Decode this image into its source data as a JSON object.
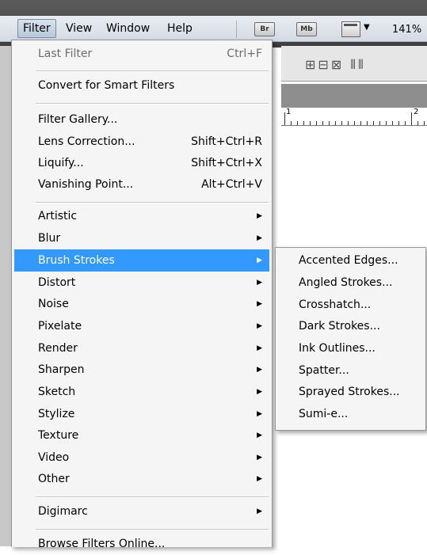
{
  "menubar": {
    "items": [
      "Filter",
      "View",
      "Window",
      "Help"
    ],
    "badges": [
      "Br",
      "Mb"
    ],
    "zoom": "141%"
  },
  "ruler": {
    "numbers": [
      "1",
      "2"
    ]
  },
  "filter_menu": {
    "last_filter": {
      "label": "Last Filter",
      "shortcut": "Ctrl+F"
    },
    "convert": "Convert for Smart Filters",
    "filter_gallery": "Filter Gallery...",
    "lens_correction": {
      "label": "Lens Correction...",
      "shortcut": "Shift+Ctrl+R"
    },
    "liquify": {
      "label": "Liquify...",
      "shortcut": "Shift+Ctrl+X"
    },
    "vanishing_point": {
      "label": "Vanishing Point...",
      "shortcut": "Alt+Ctrl+V"
    },
    "groups": [
      "Artistic",
      "Blur",
      "Brush Strokes",
      "Distort",
      "Noise",
      "Pixelate",
      "Render",
      "Sharpen",
      "Sketch",
      "Stylize",
      "Texture",
      "Video",
      "Other"
    ],
    "selected_group": "Brush Strokes",
    "digimarc": "Digimarc",
    "browse_online": "Browse Filters Online..."
  },
  "submenu": {
    "items": [
      "Accented Edges...",
      "Angled Strokes...",
      "Crosshatch...",
      "Dark Strokes...",
      "Ink Outlines...",
      "Spatter...",
      "Sprayed Strokes...",
      "Sumi-e..."
    ]
  },
  "colors": {
    "highlight": "#3399ff",
    "menu_bg": "#f5f5f5"
  },
  "icons": {
    "submenu_arrow": "arrow-right-icon",
    "dropdown": "triangle-down-icon"
  }
}
